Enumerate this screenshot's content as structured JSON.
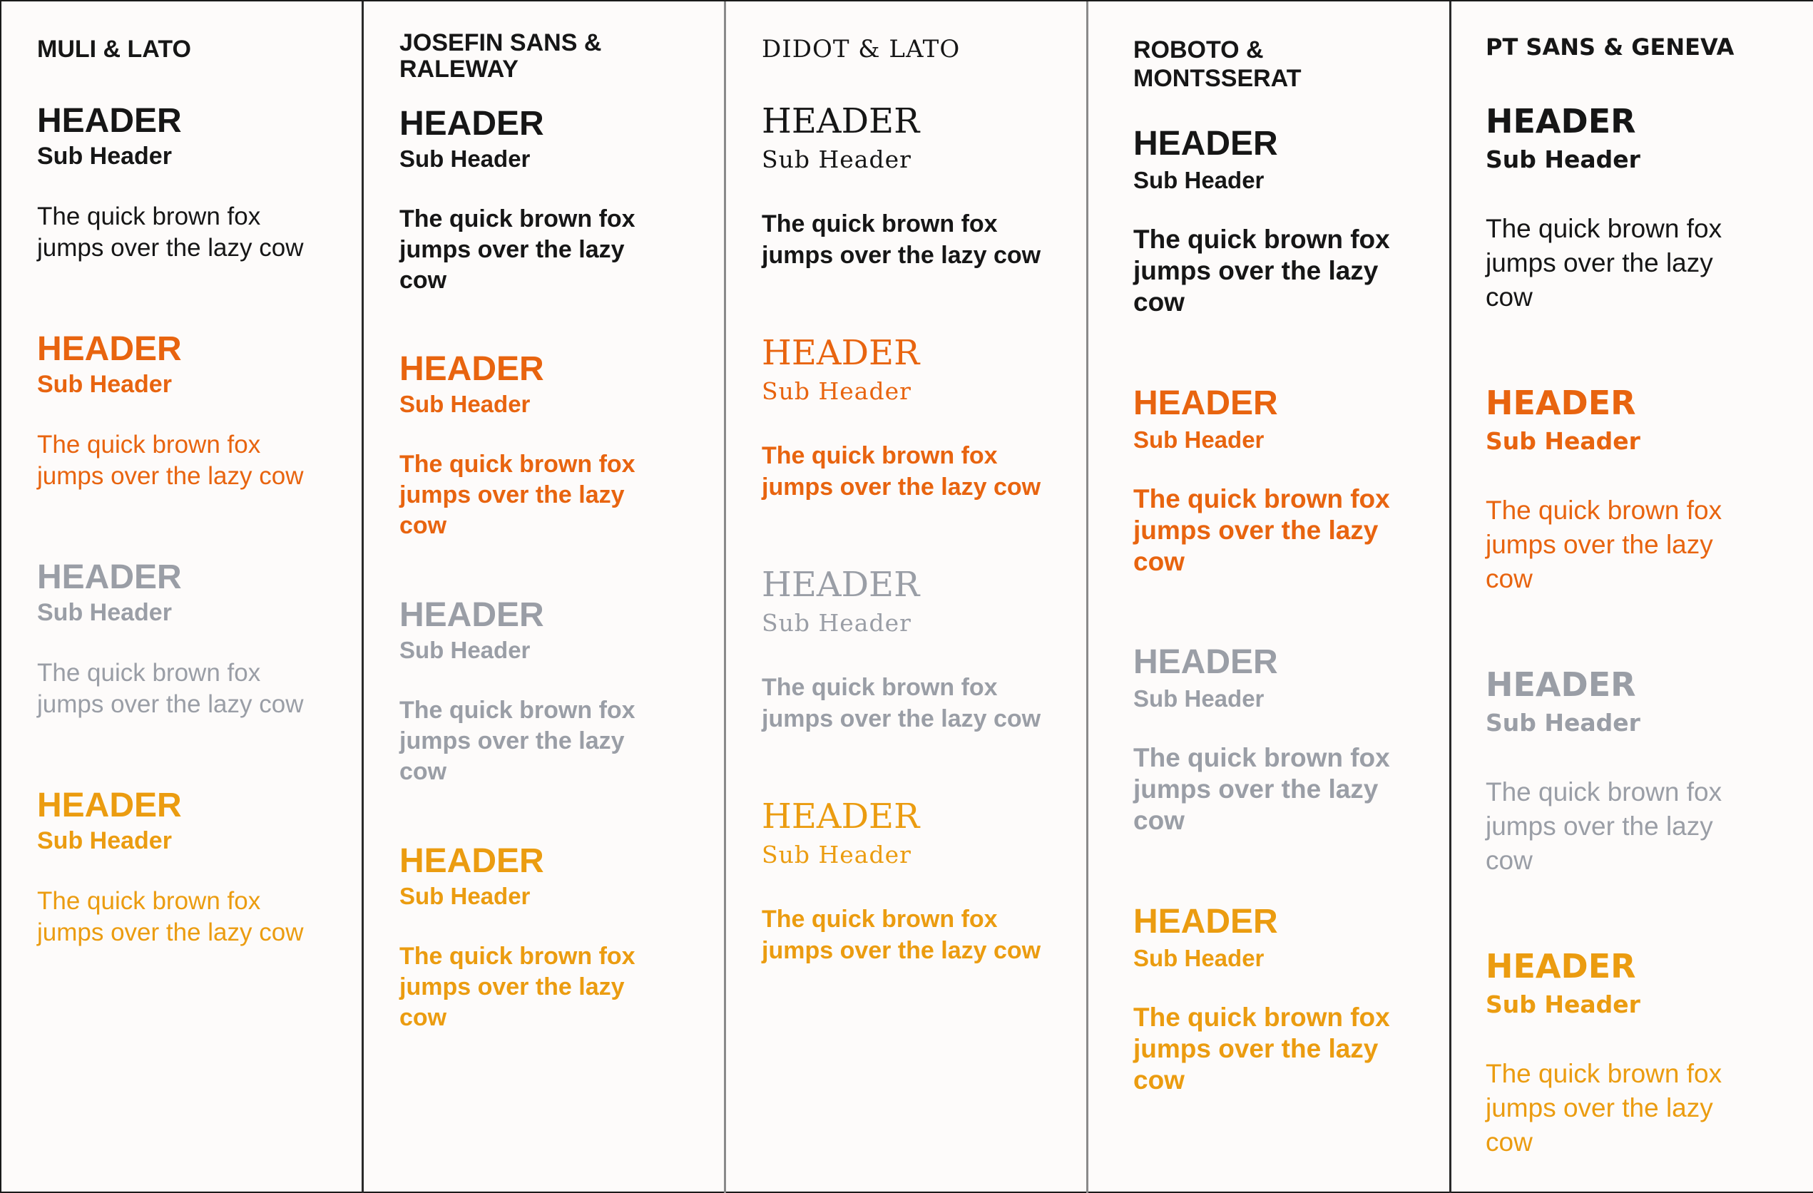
{
  "colors": {
    "black": "#161616",
    "orange": "#e8640f",
    "gray": "#9a9ea6",
    "amber": "#eb9c10"
  },
  "columns": [
    {
      "title": "MULI & LATO",
      "groups": [
        {
          "header": "HEADER",
          "sub": "Sub Header",
          "body": "The quick brown fox\njumps over the lazy cow"
        },
        {
          "header": "HEADER",
          "sub": "Sub Header",
          "body": "The quick brown fox\njumps over the lazy cow"
        },
        {
          "header": "HEADER",
          "sub": "Sub Header",
          "body": "The quick brown fox\njumps over the lazy cow"
        },
        {
          "header": "HEADER",
          "sub": "Sub Header",
          "body": "The quick brown fox\njumps over the lazy cow"
        }
      ]
    },
    {
      "title": "JOSEFIN SANS &\nRALEWAY",
      "groups": [
        {
          "header": "HEADER",
          "sub": "Sub Header",
          "body": "The quick brown fox\njumps over the lazy\ncow"
        },
        {
          "header": "HEADER",
          "sub": "Sub Header",
          "body": "The quick brown fox\njumps over the lazy\ncow"
        },
        {
          "header": "HEADER",
          "sub": "Sub Header",
          "body": "The quick brown fox\njumps over the lazy\ncow"
        },
        {
          "header": "HEADER",
          "sub": "Sub Header",
          "body": "The quick brown fox\njumps over the lazy\ncow"
        }
      ]
    },
    {
      "title": "DIDOT & LATO",
      "groups": [
        {
          "header": "HEADER",
          "sub": "Sub Header",
          "body": "The quick brown fox\njumps over the lazy cow"
        },
        {
          "header": "HEADER",
          "sub": "Sub Header",
          "body": "The quick brown fox\njumps over the lazy cow"
        },
        {
          "header": "HEADER",
          "sub": "Sub Header",
          "body": "The quick brown fox\njumps over the lazy cow"
        },
        {
          "header": "HEADER",
          "sub": "Sub Header",
          "body": "The quick brown fox\njumps over the lazy cow"
        }
      ]
    },
    {
      "title": "ROBOTO &\nMONTSSERAT",
      "groups": [
        {
          "header": "HEADER",
          "sub": "Sub Header",
          "body": "The quick brown fox\njumps over the lazy\ncow"
        },
        {
          "header": "HEADER",
          "sub": "Sub Header",
          "body": "The quick brown fox\njumps over the lazy\ncow"
        },
        {
          "header": "HEADER",
          "sub": "Sub Header",
          "body": "The quick brown fox\njumps over the lazy\ncow"
        },
        {
          "header": "HEADER",
          "sub": "Sub Header",
          "body": "The quick brown fox\njumps over the lazy\ncow"
        }
      ]
    },
    {
      "title": "PT SANS & GENEVA",
      "groups": [
        {
          "header": "HEADER",
          "sub": "Sub Header",
          "body": "The quick brown fox\njumps over the lazy\ncow"
        },
        {
          "header": "HEADER",
          "sub": "Sub Header",
          "body": "The quick brown fox\njumps over the lazy\ncow"
        },
        {
          "header": "HEADER",
          "sub": "Sub Header",
          "body": "The quick brown fox\njumps over the lazy\ncow"
        },
        {
          "header": "HEADER",
          "sub": "Sub Header",
          "body": "The quick brown fox\njumps over the lazy\ncow"
        }
      ]
    }
  ]
}
